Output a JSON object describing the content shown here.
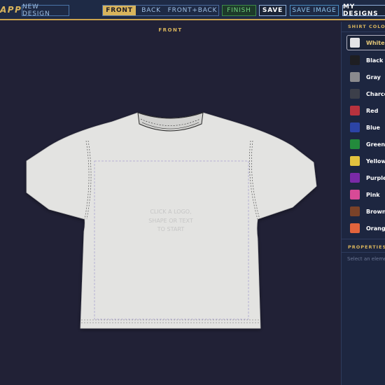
{
  "app": {
    "logo_text": "APP"
  },
  "toolbar": {
    "new_design_label": "NEW DESIGN",
    "views": [
      {
        "label": "FRONT",
        "active": true
      },
      {
        "label": "BACK",
        "active": false
      },
      {
        "label": "FRONT+BACK",
        "active": false
      }
    ],
    "finish_label": "FINISH",
    "save_label": "SAVE",
    "save_image_label": "SAVE IMAGE",
    "my_designs_label": "MY DESIGNS"
  },
  "canvas": {
    "view_label": "FRONT",
    "hint_lines": [
      "CLICK A LOGO,",
      "SHAPE OR TEXT",
      "TO START"
    ],
    "shirt_color": "#e3e3e1"
  },
  "panel": {
    "shirt_color_heading": "SHIRT COLOR",
    "colors": [
      {
        "name": "White",
        "hex": "#e4e4e6",
        "selected": true
      },
      {
        "name": "Black",
        "hex": "#1e1e22",
        "selected": false
      },
      {
        "name": "Gray",
        "hex": "#8a8a8e",
        "selected": false
      },
      {
        "name": "Charcoal",
        "hex": "#3c3f4a",
        "selected": false
      },
      {
        "name": "Red",
        "hex": "#b8323e",
        "selected": false
      },
      {
        "name": "Blue",
        "hex": "#2c44a6",
        "selected": false
      },
      {
        "name": "Green",
        "hex": "#238a3c",
        "selected": false
      },
      {
        "name": "Yellow",
        "hex": "#e2c23e",
        "selected": false
      },
      {
        "name": "Purple",
        "hex": "#7a2aa8",
        "selected": false
      },
      {
        "name": "Pink",
        "hex": "#d84a96",
        "selected": false
      },
      {
        "name": "Brown",
        "hex": "#7a4228",
        "selected": false
      },
      {
        "name": "Orange",
        "hex": "#e2643c",
        "selected": false
      }
    ],
    "properties_heading": "PROPERTIES",
    "properties_hint": "Select an element"
  }
}
